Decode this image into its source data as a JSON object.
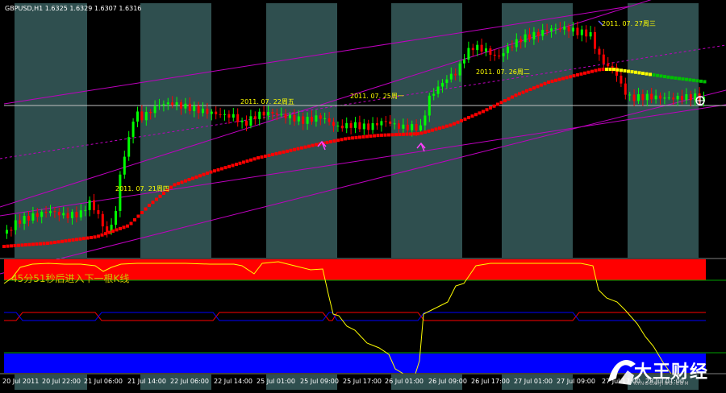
{
  "header": {
    "symbol_text": "GBPUSD,H1  1.6325 1.6329 1.6307 1.6316"
  },
  "indicator": {
    "countdown_text": "45分51秒后进入下一根K线"
  },
  "date_labels": [
    {
      "text": "2011. 07. 21周四",
      "color": "#ffff00"
    },
    {
      "text": "2011. 07. 22周五",
      "color": "#ffff00"
    },
    {
      "text": "2011. 07. 25周一",
      "color": "#ffff00"
    },
    {
      "text": "2011. 07. 26周二",
      "color": "#ffff00"
    },
    {
      "text": "2011. 07. 27周三",
      "color": "#ffff00"
    }
  ],
  "x_axis_ticks": [
    "20 Jul 2011",
    "20 Jul 22:00",
    "21 Jul 06:00",
    "21 Jul 14:00",
    "22 Jul 06:00",
    "22 Jul 14:00",
    "25 Jul 01:00",
    "25 Jul 09:00",
    "25 Jul 17:00",
    "26 Jul 01:00",
    "26 Jul 09:00",
    "26 Jul 17:00",
    "27 Jul 01:00",
    "27 Jul 09:00",
    "27 Jul 17:00",
    "28 Jul 01:00"
  ],
  "watermark": {
    "text": "大王财经",
    "url": "KINGCAIJING.COM"
  },
  "colors": {
    "background": "#000000",
    "session_band": "#2f4f4f",
    "bull": "#00ff00",
    "bear": "#ff0000",
    "channel": "#c000c0",
    "price_line": "#c0c0c0",
    "ma_red": "#ff0000",
    "ma_yellow": "#ffff00",
    "ma_green": "#00c000",
    "ind_red": "#ff0000",
    "ind_blue": "#0000ff",
    "ind_yellow": "#ffff00"
  },
  "chart_data": {
    "type": "candlestick",
    "symbol": "GBPUSD",
    "timeframe": "H1",
    "last_bar": {
      "open": 1.6325,
      "high": 1.6329,
      "low": 1.6307,
      "close": 1.6316
    },
    "x_range": [
      "20 Jul 2011",
      "28 Jul 2011 01:00"
    ],
    "overlays": [
      "upper channel line",
      "lower channel line",
      "mid channel dashed line",
      "moving average (red/yellow/green)"
    ],
    "indicator_pane": {
      "series": "yellow oscillator",
      "bands": [
        "red upper zone",
        "blue lower zone"
      ]
    }
  }
}
